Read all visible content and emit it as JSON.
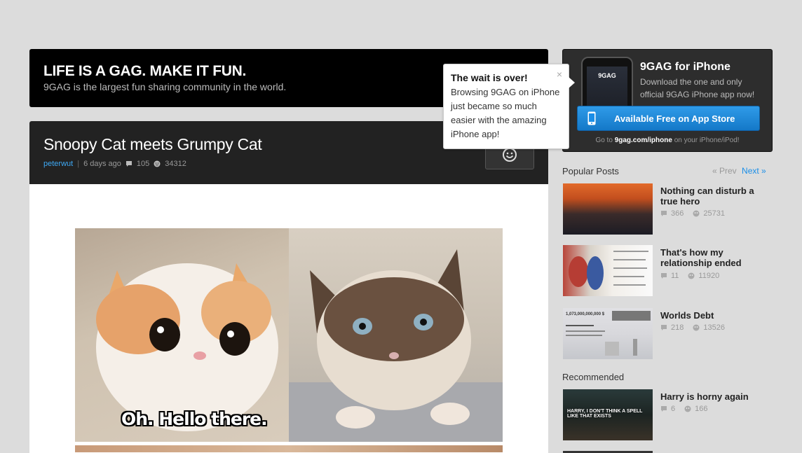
{
  "banner": {
    "headline": "LIFE IS A GAG. MAKE IT FUN.",
    "subline": "9GAG is the largest fun sharing community in the world."
  },
  "tooltip": {
    "title": "The wait is over!",
    "body": "Browsing 9GAG on iPhone just became so much easier with the amazing iPhone app!",
    "close": "×"
  },
  "post": {
    "title": "Snoopy Cat meets Grumpy Cat",
    "author": "peterwut",
    "separator": "|",
    "time": "6 days ago",
    "comments": "105",
    "points": "34312",
    "caption": "Oh. Hello there."
  },
  "promo": {
    "phone_logo": "9GAG",
    "title": "9GAG for iPhone",
    "description": "Download the one and only official 9GAG iPhone app now!",
    "button_label": "Available Free on App Store",
    "goto_prefix": "Go to",
    "goto_url": "9gag.com/iphone",
    "goto_suffix": "on your iPhone/iPod!"
  },
  "popular": {
    "title": "Popular Posts",
    "prev": "« Prev",
    "next": "Next »",
    "items": [
      {
        "title": "Nothing can disturb a true hero",
        "comments": "366",
        "points": "25731"
      },
      {
        "title": "That's how my relationship ended",
        "comments": "11",
        "points": "11920"
      },
      {
        "title": "Worlds Debt",
        "comments": "218",
        "points": "13526",
        "thumb_text": "1,073,000,000,000 $"
      }
    ]
  },
  "recommended": {
    "title": "Recommended",
    "items": [
      {
        "title": "Harry is horny again",
        "comments": "6",
        "points": "166",
        "thumb_text": "HARRY, I DON'T THINK A SPELL LIKE THAT EXISTS"
      }
    ]
  },
  "colors": {
    "accent_link": "#3ea9f5",
    "store_button": "#1a8ee8",
    "banner_bg": "#000000",
    "post_header_bg": "#222222"
  }
}
